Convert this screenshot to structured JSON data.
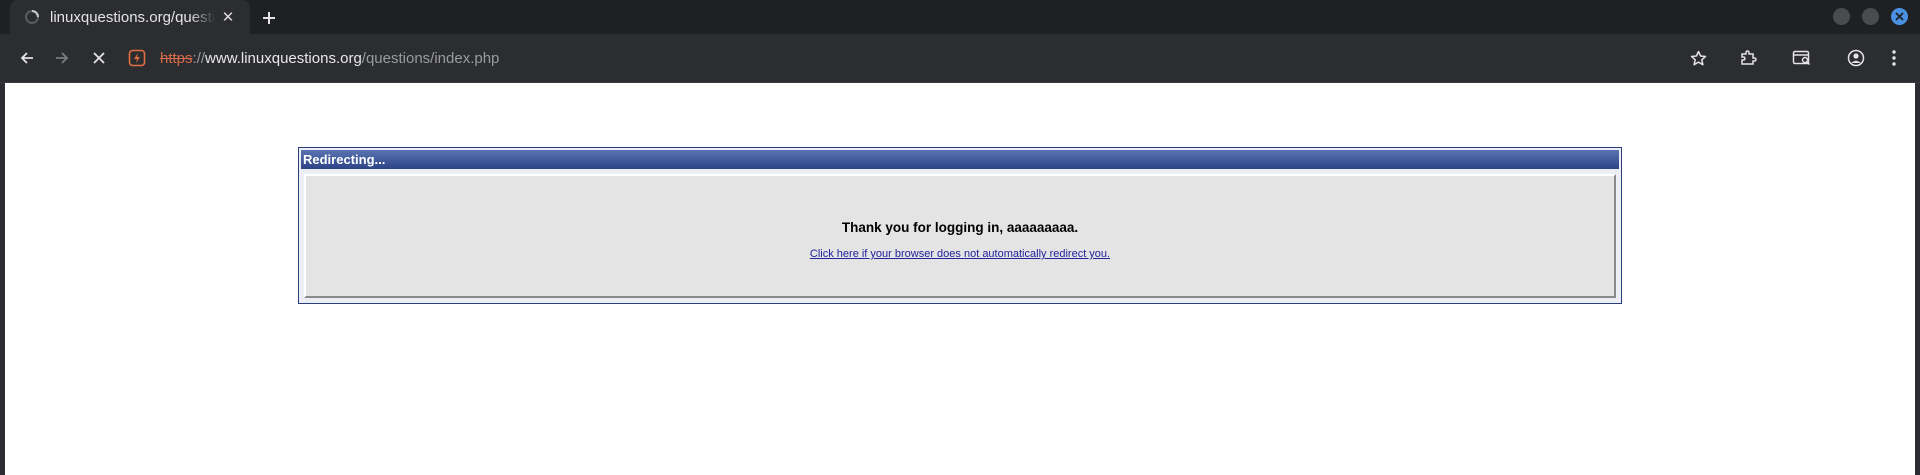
{
  "browser": {
    "tab": {
      "title": "linuxquestions.org/questions/index.php",
      "close_icon": "close-icon",
      "favicon": "loading-spinner-icon"
    },
    "new_tab_icon": "plus-icon",
    "window_controls": [
      "minimize-icon",
      "maximize-icon",
      "close-icon"
    ],
    "toolbar": {
      "back_icon": "arrow-left-icon",
      "forward_icon": "arrow-right-icon",
      "stop_icon": "close-icon",
      "site_icon": "not-secure-warning-icon",
      "url": {
        "scheme": "https",
        "separator": "://",
        "host": "www.linuxquestions.org",
        "path": "/questions/index.php"
      },
      "bookmark_icon": "star-icon",
      "extensions_icon": "puzzle-icon",
      "tab_search_icon": "tab-search-icon",
      "profile_icon": "profile-icon",
      "menu_icon": "kebab-menu-icon"
    },
    "colors": {
      "chrome_dark": "#2c2d30",
      "tabstrip": "#1f2023",
      "insecure_scheme": "#d46b4a",
      "close_window": "#4a90e2"
    }
  },
  "page": {
    "panel_title": "Redirecting...",
    "message": "Thank you for logging in, aaaaaaaaa.",
    "redirect_link": "Click here if your browser does not automatically redirect you.",
    "colors": {
      "header_top": "#5a73b0",
      "header_bottom": "#2c4487",
      "body_bg": "#e4e4e4",
      "link": "#22229c"
    }
  }
}
